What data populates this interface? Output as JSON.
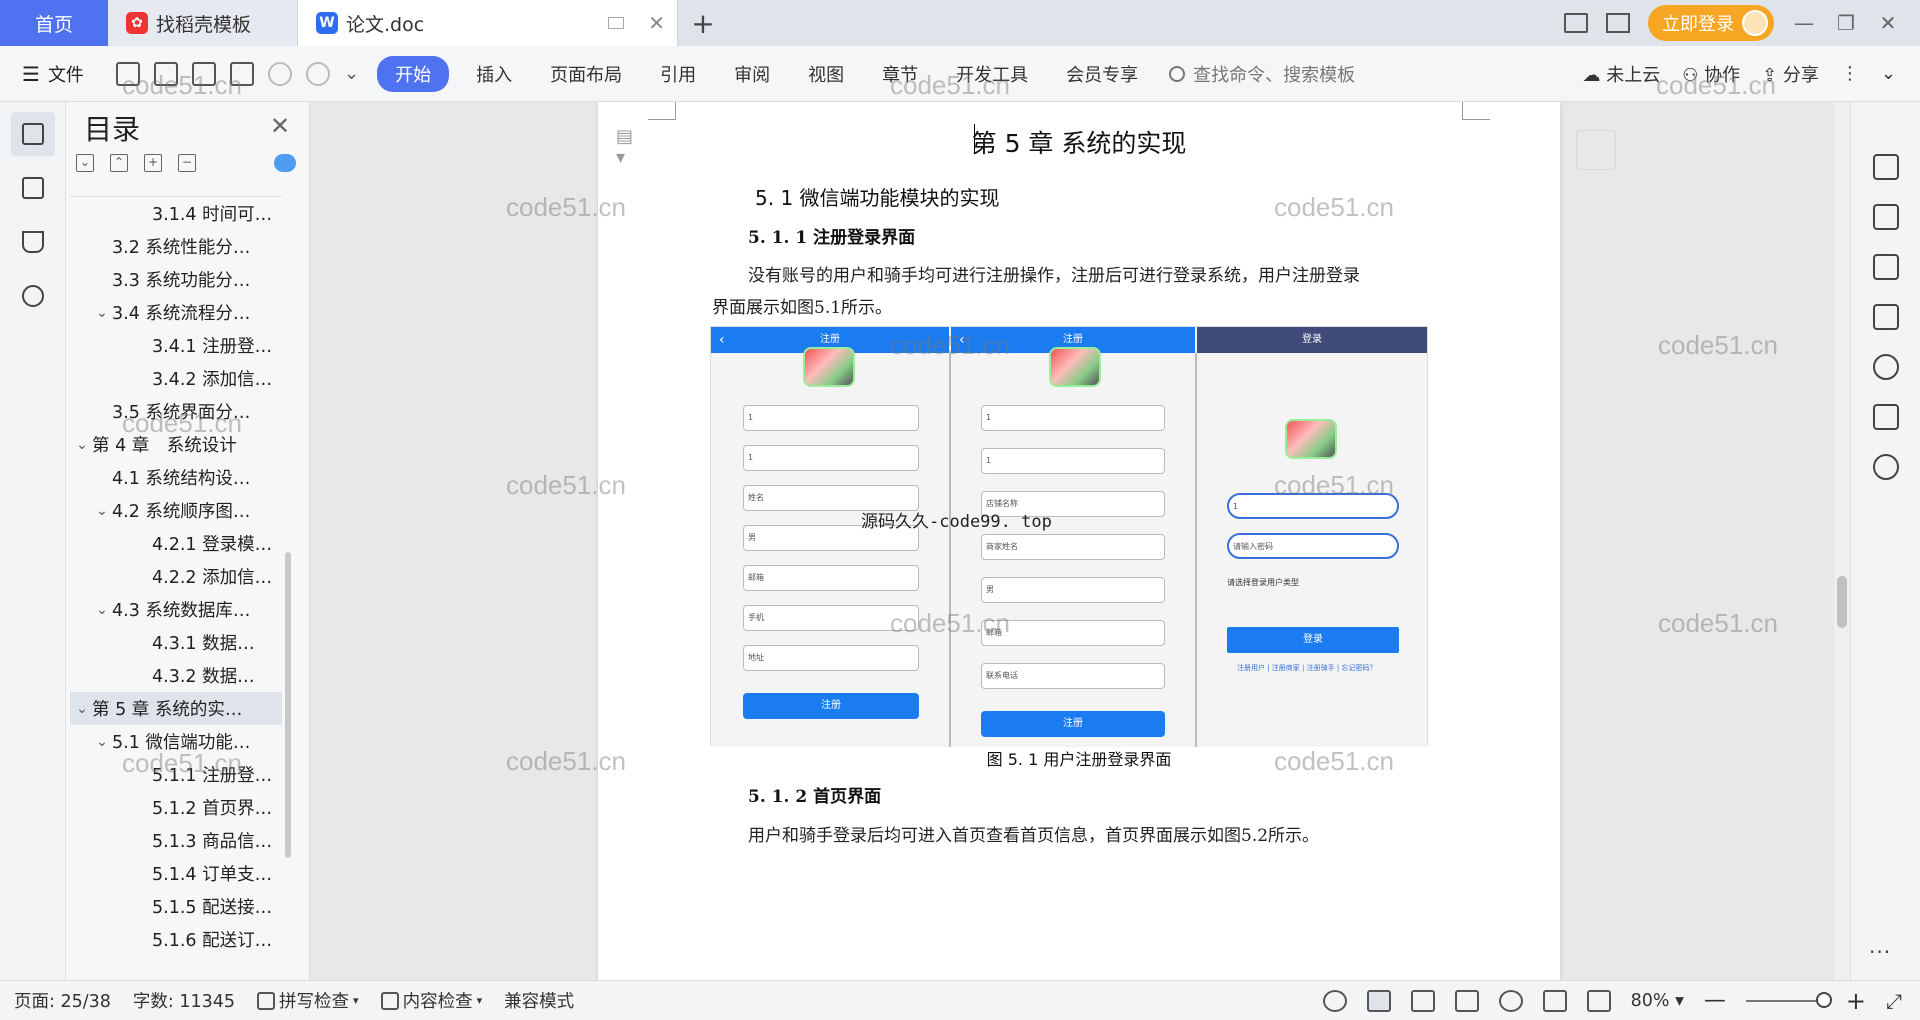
{
  "tabs": {
    "home": "首页",
    "template": "找稻壳模板",
    "doc": "论文.doc",
    "add": "+",
    "login": "立即登录"
  },
  "toolbar": {
    "file": "文件",
    "menu": [
      "开始",
      "插入",
      "页面布局",
      "引用",
      "审阅",
      "视图",
      "章节",
      "开发工具",
      "会员专享"
    ],
    "search": "查找命令、搜索模板",
    "cloud": "未上云",
    "collab": "协作",
    "share": "分享"
  },
  "toc": {
    "title": "目录",
    "items": [
      {
        "label": "3.1.4 时间可…",
        "level": 3
      },
      {
        "label": "3.2  系统性能分…",
        "level": 2
      },
      {
        "label": "3.3  系统功能分…",
        "level": 2
      },
      {
        "label": "3.4  系统流程分…",
        "level": 2,
        "expanded": true
      },
      {
        "label": "3.4.1 注册登…",
        "level": 3
      },
      {
        "label": "3.4.2 添加信…",
        "level": 3
      },
      {
        "label": "3.5 系统界面分…",
        "level": 2
      },
      {
        "label": "第 4 章　系统设计",
        "level": 1,
        "expanded": true
      },
      {
        "label": "4.1 系统结构设…",
        "level": 2
      },
      {
        "label": "4.2 系统顺序图…",
        "level": 2,
        "expanded": true
      },
      {
        "label": "4.2.1 登录模…",
        "level": 3
      },
      {
        "label": "4.2.2 添加信…",
        "level": 3
      },
      {
        "label": "4.3 系统数据库…",
        "level": 2,
        "expanded": true
      },
      {
        "label": "4.3.1  数据…",
        "level": 3
      },
      {
        "label": "4.3.2  数据…",
        "level": 3
      },
      {
        "label": "第 5 章  系统的实…",
        "level": 1,
        "expanded": true,
        "selected": true
      },
      {
        "label": "5.1 微信端功能…",
        "level": 2,
        "expanded": true
      },
      {
        "label": "5.1.1 注册登…",
        "level": 3
      },
      {
        "label": "5.1.2 首页界…",
        "level": 3
      },
      {
        "label": "5.1.3 商品信…",
        "level": 3
      },
      {
        "label": "5.1.4 订单支…",
        "level": 3
      },
      {
        "label": "5.1.5 配送接…",
        "level": 3
      },
      {
        "label": "5.1.6 配送订…",
        "level": 3
      }
    ]
  },
  "document": {
    "chapter": "第 5 章  系统的实现",
    "h2": "5. 1 微信端功能模块的实现",
    "h3_1": "5. 1. 1 注册登录界面",
    "para1_line1": "没有账号的用户和骑手均可进行注册操作，注册后可进行登录系统，用户注册登录",
    "para1_line2": "界面展示如图5.1所示。",
    "figure_caption": "图 5. 1  用户注册登录界面",
    "h3_2": "5. 1. 2 首页界面",
    "para2": "用户和骑手登录后均可进入首页查看首页信息，首页界面展示如图5.2所示。",
    "overlay": "源码久久-code99. top",
    "watermark": "code51.cn",
    "figure": {
      "panel1_title": "注册",
      "panel2_title": "注册",
      "panel3_title": "登录",
      "panel1_fields": [
        "1",
        "1",
        "姓名",
        "男",
        "邮箱",
        "手机",
        "地址"
      ],
      "panel1_button": "注册",
      "panel2_fields": [
        "1",
        "1",
        "店铺名称",
        "商家姓名",
        "男",
        "邮箱",
        "联系电话"
      ],
      "panel2_button": "注册",
      "panel3_fields": [
        "1",
        "请输入密码"
      ],
      "panel3_hint": "请选择登录用户类型",
      "panel3_button": "登录",
      "panel3_links": "注册用户 | 注册商家 | 注册骑手 | 忘记密码？"
    }
  },
  "status": {
    "page": "页面: 25/38",
    "words": "字数: 11345",
    "spell": "拼写检查",
    "content": "内容检查",
    "compat": "兼容模式",
    "zoom": "80%"
  },
  "colors": {
    "accent": "#4f72f0",
    "login": "#f6a623",
    "phone_blue": "#1a7cf0",
    "login_bar": "#3f4a7a"
  }
}
